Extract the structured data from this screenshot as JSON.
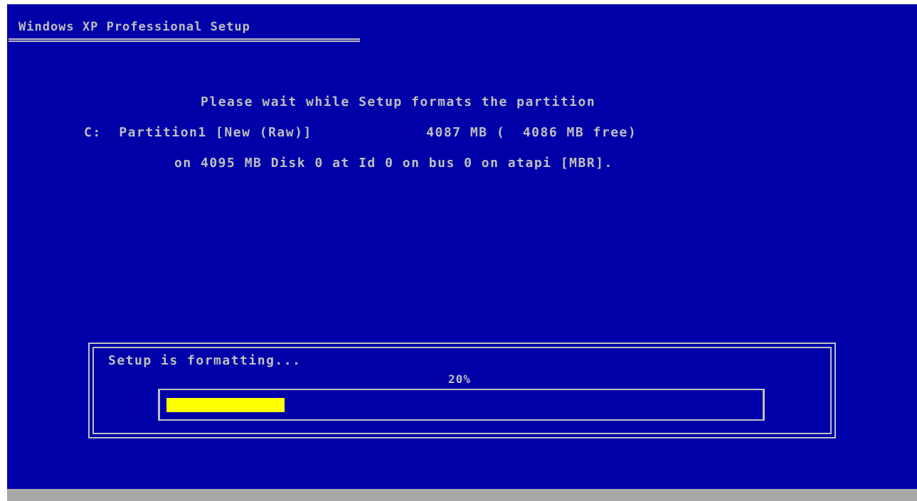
{
  "setup": {
    "title": "Windows XP Professional Setup",
    "message": "Please wait while Setup formats the partition",
    "partition_line": "C:  Partition1 [New (Raw)]             4087 MB (  4086 MB free)",
    "disk_line": "on 4095 MB Disk 0 at Id 0 on bus 0 on atapi [MBR].",
    "progress": {
      "label": "Setup is formatting...",
      "percent_text": "20%",
      "fraction": 0.2
    }
  },
  "colors": {
    "background": "#0000a8",
    "text": "#c0c0c0",
    "progress_fill": "#ffff00",
    "status_bar": "#a8a8a8"
  }
}
